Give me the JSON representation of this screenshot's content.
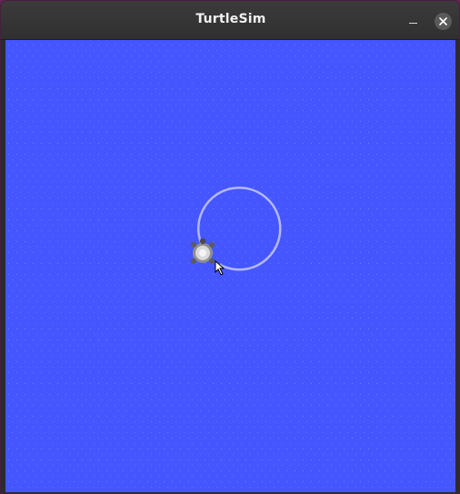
{
  "window": {
    "title": "TurtleSim",
    "controls": {
      "minimize_icon": "minimize-icon",
      "close_icon": "close-icon"
    }
  },
  "sim": {
    "background_color": "#4556ff",
    "pen_color": "#b3b8ff",
    "turtle_icon": "turtle-icon",
    "pointer_icon": "mouse-pointer-icon"
  }
}
